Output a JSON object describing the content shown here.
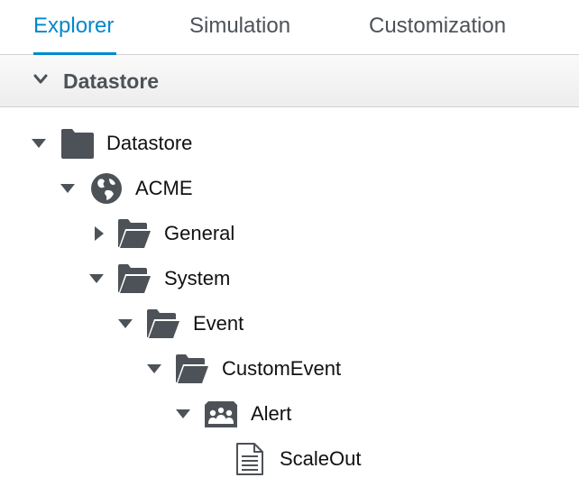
{
  "tabs": [
    {
      "label": "Explorer",
      "active": true
    },
    {
      "label": "Simulation",
      "active": false
    },
    {
      "label": "Customization",
      "active": false
    }
  ],
  "accordion": {
    "title": "Datastore",
    "icon": "chevron-down-icon",
    "expanded": true
  },
  "tree": [
    {
      "label": "Datastore",
      "icon": "folder-icon",
      "state": "expanded"
    },
    {
      "label": "ACME",
      "icon": "globe-icon",
      "state": "expanded"
    },
    {
      "label": "General",
      "icon": "folder-open-icon",
      "state": "collapsed"
    },
    {
      "label": "System",
      "icon": "folder-open-icon",
      "state": "expanded"
    },
    {
      "label": "Event",
      "icon": "folder-open-icon",
      "state": "expanded"
    },
    {
      "label": "CustomEvent",
      "icon": "folder-open-icon",
      "state": "expanded"
    },
    {
      "label": "Alert",
      "icon": "class-icon",
      "state": "expanded"
    },
    {
      "label": "ScaleOut",
      "icon": "document-icon",
      "state": "leaf"
    }
  ],
  "colors": {
    "accent": "#0088ce",
    "icon": "#4d5258"
  }
}
